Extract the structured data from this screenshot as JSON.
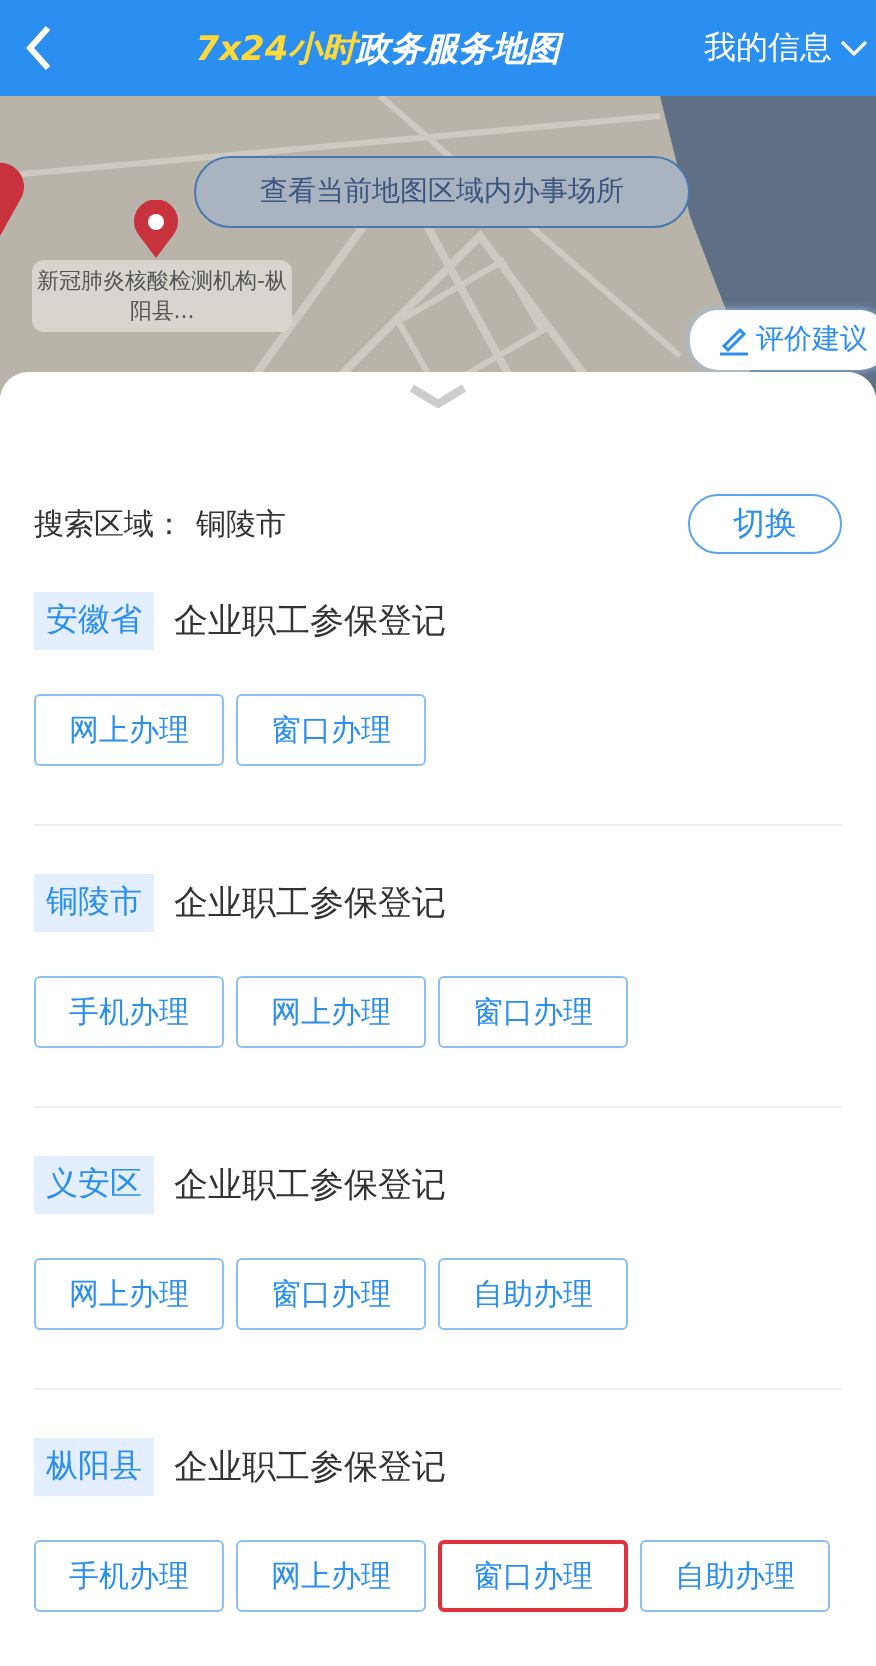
{
  "header": {
    "title_highlight": "7x24小时",
    "title_rest": "政务服务地图",
    "menu": "我的信息"
  },
  "map": {
    "kind": "picture",
    "area_button": "查看当前地图区域内办事场所",
    "marker_label": "新冠肺炎核酸检测机构-枞阳县...",
    "feedback_button": "评价建议"
  },
  "search": {
    "label": "搜索区域：",
    "value": "铜陵市",
    "switch_button": "切换"
  },
  "sections": [
    {
      "region": "安徽省",
      "service": "企业职工参保登记",
      "buttons": [
        {
          "label": "网上办理",
          "highlighted": false
        },
        {
          "label": "窗口办理",
          "highlighted": false
        }
      ]
    },
    {
      "region": "铜陵市",
      "service": "企业职工参保登记",
      "buttons": [
        {
          "label": "手机办理",
          "highlighted": false
        },
        {
          "label": "网上办理",
          "highlighted": false
        },
        {
          "label": "窗口办理",
          "highlighted": false
        }
      ]
    },
    {
      "region": "义安区",
      "service": "企业职工参保登记",
      "buttons": [
        {
          "label": "网上办理",
          "highlighted": false
        },
        {
          "label": "窗口办理",
          "highlighted": false
        },
        {
          "label": "自助办理",
          "highlighted": false
        }
      ]
    },
    {
      "region": "枞阳县",
      "service": "企业职工参保登记",
      "buttons": [
        {
          "label": "手机办理",
          "highlighted": false
        },
        {
          "label": "网上办理",
          "highlighted": false
        },
        {
          "label": "窗口办理",
          "highlighted": true
        },
        {
          "label": "自助办理",
          "highlighted": false
        }
      ]
    }
  ]
}
